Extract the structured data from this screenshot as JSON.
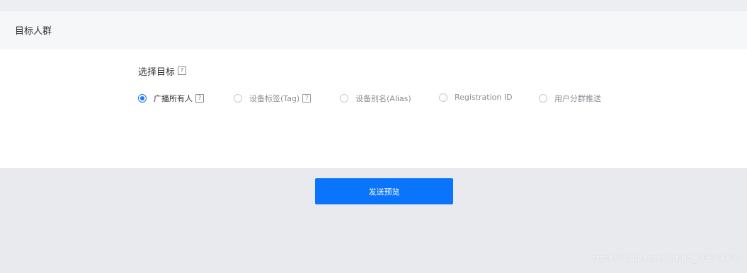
{
  "card": {
    "title": "目标人群"
  },
  "target": {
    "label": "选择目标",
    "help_icon": "help-question-icon"
  },
  "options": [
    {
      "label": "广播所有人",
      "checked": true,
      "disabled": false,
      "has_help": true
    },
    {
      "label": "设备标签(Tag)",
      "checked": false,
      "disabled": true,
      "has_help": true
    },
    {
      "label": "设备别名(Alias)",
      "checked": false,
      "disabled": true,
      "has_help": false
    },
    {
      "label": "Registration ID",
      "checked": false,
      "disabled": true,
      "has_help": false
    },
    {
      "label": "用户分群推送",
      "checked": false,
      "disabled": true,
      "has_help": false
    }
  ],
  "actions": {
    "send_preview_label": "发送预览"
  },
  "watermark": "https://blog.csdn.net/qq_36699930",
  "colors": {
    "accent": "#1677ff",
    "button": "#0a74fa",
    "page_bg": "#e9eaee"
  }
}
